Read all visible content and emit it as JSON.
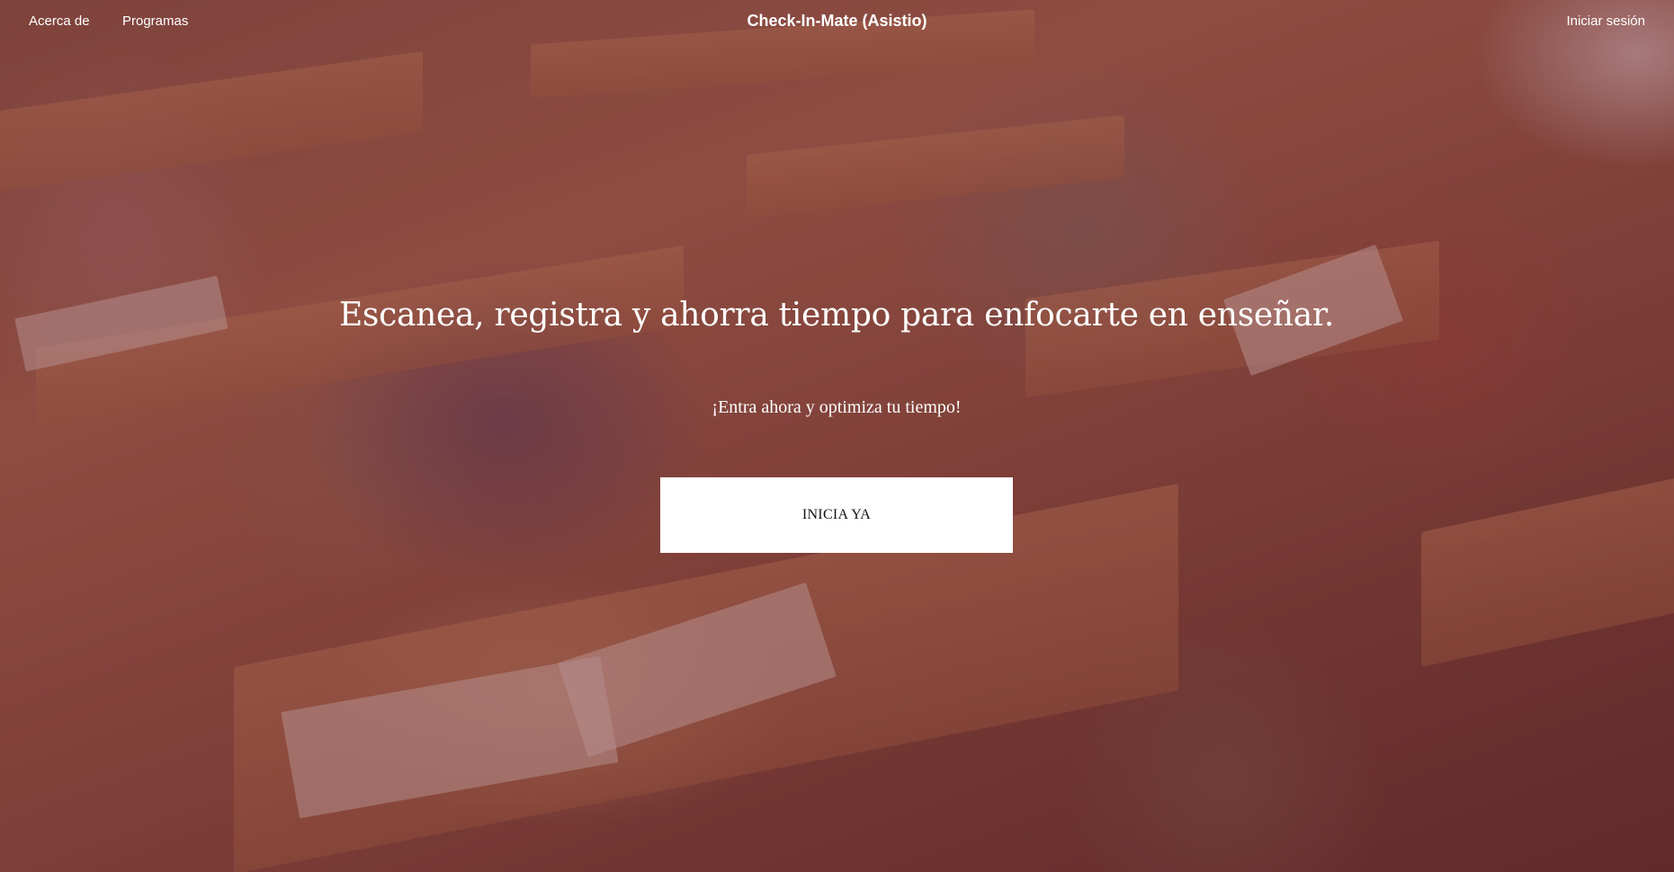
{
  "nav": {
    "about": "Acerca de",
    "programs": "Programas",
    "brand": "Check-In-Mate (Asistio)",
    "login": "Iniciar sesión"
  },
  "hero": {
    "headline": "Escanea, registra y ahorra tiempo para enfocarte en enseñar.",
    "subline": "¡Entra ahora y optimiza tu tiempo!",
    "cta_label": "INICIA YA",
    "background": "classroom-students-writing-photo"
  },
  "colors": {
    "overlay": "#6e2328",
    "text": "#ffffff",
    "button_bg": "#ffffff",
    "button_text": "#111111"
  }
}
